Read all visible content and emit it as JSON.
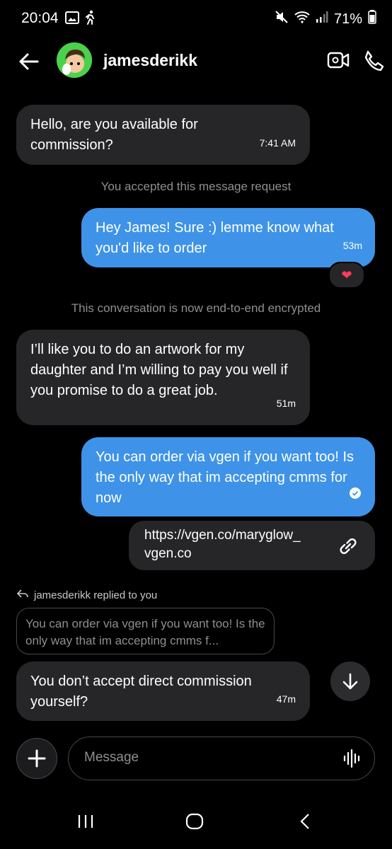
{
  "status": {
    "time": "20:04",
    "battery": "71%"
  },
  "header": {
    "username": "jamesderikk"
  },
  "messages": {
    "m1_text": "Hello, are you available for commission?",
    "m1_time": "7:41 AM",
    "sys1": "You accepted this message request",
    "m2_text": "Hey James! Sure :) lemme know what you'd like to order",
    "m2_time": "53m",
    "m2_reaction": "❤",
    "sys2": "This conversation is now end-to-end encrypted",
    "m3_text": "I’ll like you to do an artwork for my daughter and I’m willing to pay you well if you promise to do a great job.",
    "m3_time": "51m",
    "m4_text": "You can order via vgen if you want too! Is the only way that im accepting cmms for now",
    "link_url": "https://vgen.co/maryglow_",
    "link_domain": "vgen.co",
    "reply_label": "jamesderikk replied to you",
    "quote_text": "You can order via vgen if you want too! Is the only way that im accepting cmms f...",
    "m5_text": "You don’t accept direct commission yourself?",
    "m5_time": "47m"
  },
  "composer": {
    "placeholder": "Message"
  },
  "colors": {
    "outgoing": "#3e93e8",
    "incoming": "#262629",
    "background": "#000000"
  }
}
